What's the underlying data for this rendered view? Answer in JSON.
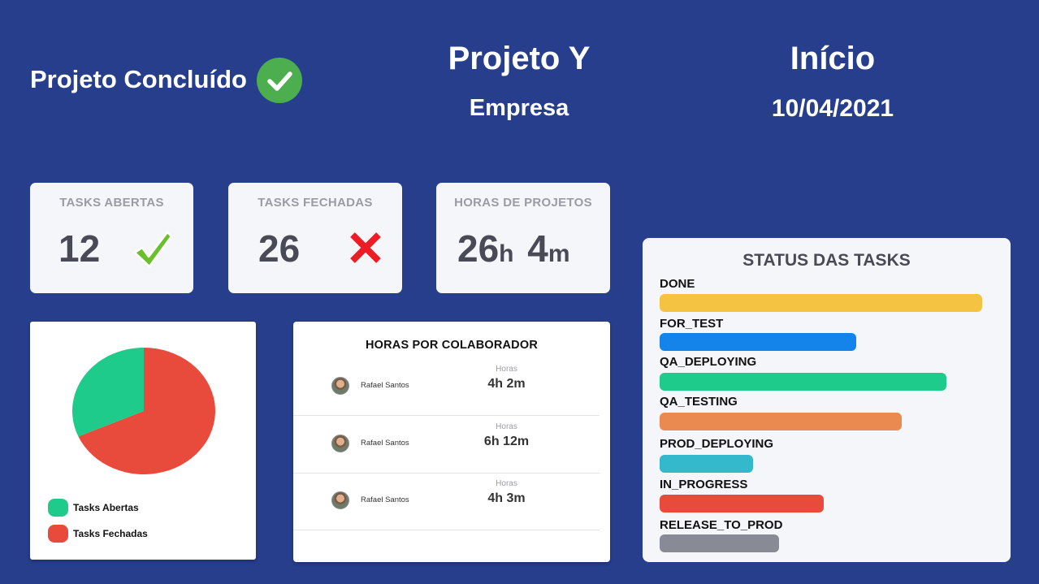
{
  "header": {
    "status_text": "Projeto Concluído",
    "status_icon": "check-circle-icon",
    "status_color": "#4cae4f",
    "project_name": "Projeto Y",
    "company": "Empresa",
    "start_label": "Início",
    "start_date": "10/04/2021"
  },
  "kpis": {
    "open_tasks": {
      "label": "TASKS ABERTAS",
      "value": "12",
      "icon": "green-checkmark-icon"
    },
    "closed_tasks": {
      "label": "TASKS FECHADAS",
      "value": "26",
      "icon": "red-x-icon"
    },
    "project_hours": {
      "label": "HORAS DE PROJETOS",
      "hours": "26",
      "hours_unit": "h",
      "minutes": "4",
      "minutes_unit": "m"
    }
  },
  "pie": {
    "legend": [
      {
        "label": "Tasks Abertas",
        "color": "#1ecb8b"
      },
      {
        "label": "Tasks Fechadas",
        "color": "#e84b3c"
      }
    ]
  },
  "hours_table": {
    "title": "HORAS POR COLABORADOR",
    "rows": [
      {
        "name": "Rafael Santos",
        "col_label": "Horas",
        "value": "4h 2m"
      },
      {
        "name": "Rafael Santos",
        "col_label": "Horas",
        "value": "6h 12m"
      },
      {
        "name": "Rafael Santos",
        "col_label": "Horas",
        "value": "4h 3m"
      }
    ]
  },
  "status_tasks": {
    "title": "STATUS DAS TASKS",
    "items": [
      {
        "label": "DONE",
        "fraction": 1.0,
        "color": "#f5c342"
      },
      {
        "label": "FOR_TEST",
        "fraction": 0.61,
        "color": "#1483ea"
      },
      {
        "label": "QA_DEPLOYING",
        "fraction": 0.89,
        "color": "#1ecb8b"
      },
      {
        "label": "QA_TESTING",
        "fraction": 0.75,
        "color": "#eb8a50"
      },
      {
        "label": "PROD_DEPLOYING",
        "fraction": 0.29,
        "color": "#34b8cc"
      },
      {
        "label": "IN_PROGRESS",
        "fraction": 0.51,
        "color": "#e84b3c"
      },
      {
        "label": "RELEASE_TO_PROD",
        "fraction": 0.37,
        "color": "#888a96"
      }
    ]
  },
  "chart_data": {
    "type": "pie",
    "labels": [
      "Tasks Abertas",
      "Tasks Fechadas"
    ],
    "values": [
      12,
      26
    ],
    "colors": [
      "#1ecb8b",
      "#e84b3c"
    ]
  }
}
